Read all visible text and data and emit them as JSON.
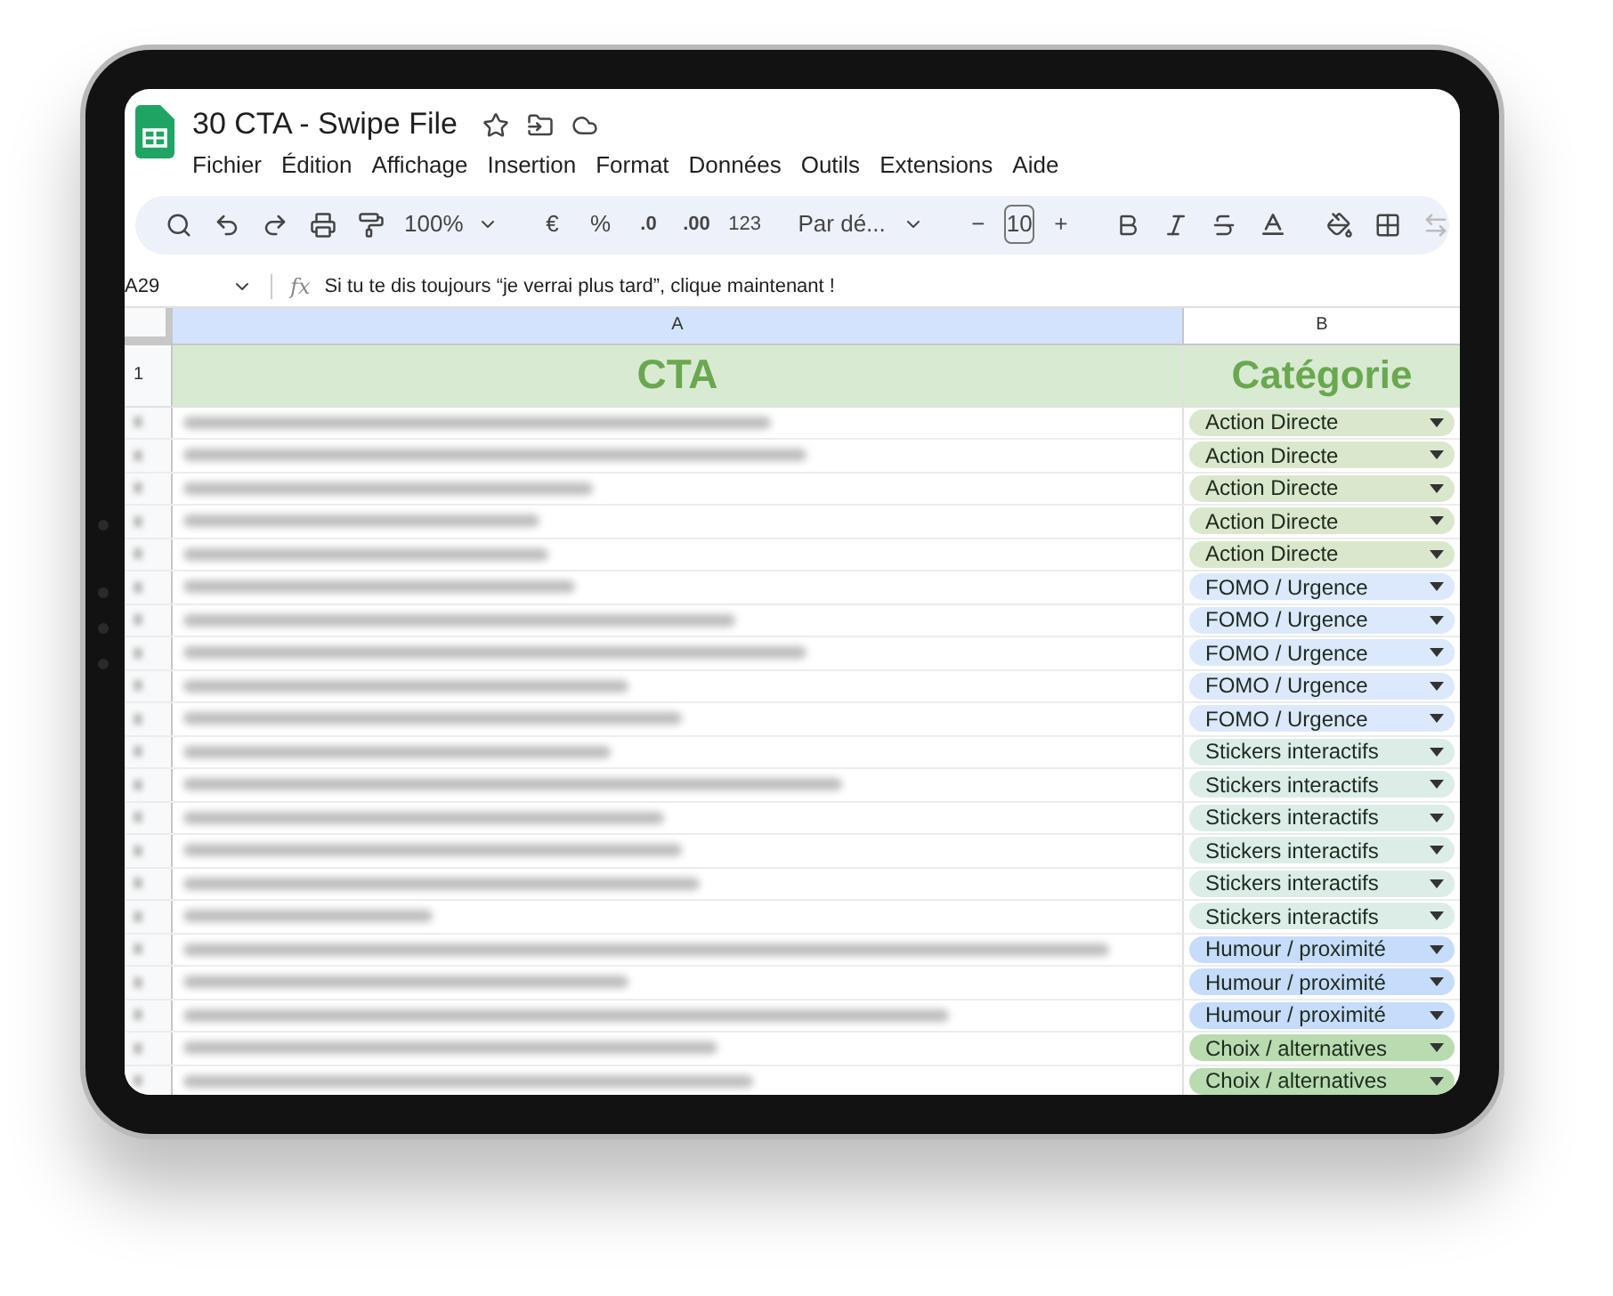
{
  "document": {
    "title": "30 CTA - Swipe File"
  },
  "menu": [
    "Fichier",
    "Édition",
    "Affichage",
    "Insertion",
    "Format",
    "Données",
    "Outils",
    "Extensions",
    "Aide"
  ],
  "toolbar": {
    "zoom": "100%",
    "currency": "€",
    "percent": "%",
    "decrease_decimal": ".0",
    "increase_decimal": ".00",
    "number_format": "123",
    "font": "Par dé...",
    "minus": "−",
    "font_size": "10",
    "plus": "+"
  },
  "formula_bar": {
    "cell": "A29",
    "fx": "fx",
    "value": "Si tu te dis toujours “je verrai plus tard”, clique maintenant !"
  },
  "columns": [
    "A",
    "B"
  ],
  "header_row": {
    "number": "1",
    "cta": "CTA",
    "category": "Catégorie"
  },
  "rows": [
    {
      "category": "Action Directe",
      "color": "#d9e8cc"
    },
    {
      "category": "Action Directe",
      "color": "#d9e8cc"
    },
    {
      "category": "Action Directe",
      "color": "#d9e8cc"
    },
    {
      "category": "Action Directe",
      "color": "#d9e8cc"
    },
    {
      "category": "Action Directe",
      "color": "#d9e8cc"
    },
    {
      "category": "FOMO / Urgence",
      "color": "#dce8fb"
    },
    {
      "category": "FOMO / Urgence",
      "color": "#dce8fb"
    },
    {
      "category": "FOMO / Urgence",
      "color": "#dce8fb"
    },
    {
      "category": "FOMO / Urgence",
      "color": "#dce8fb"
    },
    {
      "category": "FOMO / Urgence",
      "color": "#dce8fb"
    },
    {
      "category": "Stickers interactifs",
      "color": "#dcede8"
    },
    {
      "category": "Stickers interactifs",
      "color": "#dcede8"
    },
    {
      "category": "Stickers interactifs",
      "color": "#dcede8"
    },
    {
      "category": "Stickers interactifs",
      "color": "#dcede8"
    },
    {
      "category": "Stickers interactifs",
      "color": "#dcede8"
    },
    {
      "category": "Stickers interactifs",
      "color": "#dcede8"
    },
    {
      "category": "Humour / proximité",
      "color": "#c5dcfb"
    },
    {
      "category": "Humour / proximité",
      "color": "#c5dcfb"
    },
    {
      "category": "Humour / proximité",
      "color": "#c5dcfb"
    },
    {
      "category": "Choix / alternatives",
      "color": "#b8dcb0"
    },
    {
      "category": "Choix / alternatives",
      "color": "#b8dcb0"
    }
  ]
}
